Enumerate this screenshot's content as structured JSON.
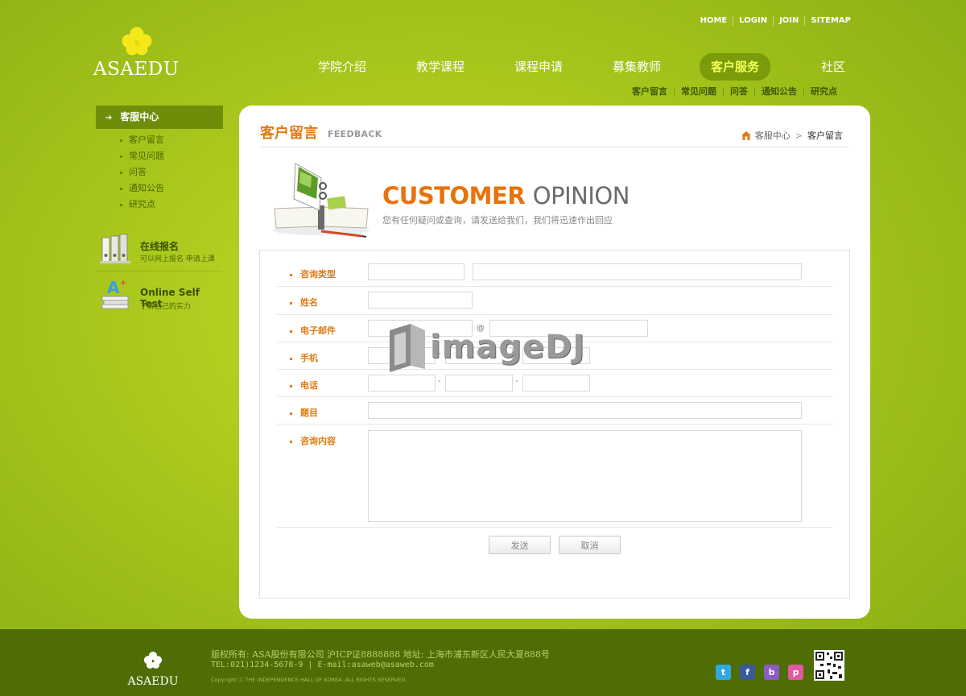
{
  "brand": {
    "name": "ASAEDU",
    "flower_color": "#f5e81a"
  },
  "top_links": [
    "HOME",
    "LOGIN",
    "JOIN",
    "SITEMAP"
  ],
  "main_nav": [
    {
      "label": "学院介绍",
      "active": false
    },
    {
      "label": "教学课程",
      "active": false
    },
    {
      "label": "课程申请",
      "active": false
    },
    {
      "label": "募集教师",
      "active": false
    },
    {
      "label": "客户服务",
      "active": true
    },
    {
      "label": "社区",
      "active": false
    }
  ],
  "sub_nav": [
    "客户留言",
    "常见问题",
    "问答",
    "通知公告",
    "研究点"
  ],
  "sidebar": {
    "title": "客服中心",
    "items": [
      "客户留言",
      "常见问题",
      "问答",
      "通知公告",
      "研究点"
    ],
    "promo_register": {
      "title": "在线报名",
      "subtitle": "可以网上报名 申请上课"
    },
    "promo_test": {
      "title": "Online Self Test",
      "subtitle": "了解自己的实力"
    }
  },
  "content": {
    "title": "客户留言",
    "title_en": "FEEDBACK",
    "breadcrumb": {
      "parent": "客服中心",
      "sep": ">",
      "current": "客户留言"
    },
    "hero": {
      "title_orange": "CUSTOMER",
      "title_grey": "OPINION",
      "subtitle": "您有任何疑问或查询，请发送给我们，我们将迅速作出回应"
    },
    "form": {
      "labels": {
        "type": "咨询类型",
        "name": "姓名",
        "email": "电子邮件",
        "mobile": "手机",
        "phone": "电话",
        "subject": "题目",
        "content": "咨询内容"
      },
      "at_sign": "@",
      "dash": "-",
      "submit_label": "发送",
      "cancel_label": "取消"
    }
  },
  "watermark": {
    "text": "imageDJ"
  },
  "footer": {
    "brand": "ASAEDU",
    "line1": "版权所有: ASA股份有限公司 沪ICP证8888888 地址: 上海市浦东新区人民大夏888号",
    "line2": "TEL:021)1234-5678-9 | E-mail:asaweb@asaweb.com",
    "line3": "Copyright ⓒ THE INDEPENDENCE HALL OF KOREA. ALL RIGHTS RESERVED.",
    "social": [
      {
        "name": "twitter-icon",
        "glyph": "t",
        "color": "#2fa9e0"
      },
      {
        "name": "facebook-icon",
        "glyph": "f",
        "color": "#3b5998"
      },
      {
        "name": "blog-icon",
        "glyph": "b",
        "color": "#8b5cc4"
      },
      {
        "name": "piggy-icon",
        "glyph": "p",
        "color": "#e05aa0"
      }
    ]
  },
  "colors": {
    "accent_orange": "#e07a10",
    "nav_active_bg": "#7a9c0a",
    "footer_bg": "#4e6d05"
  }
}
